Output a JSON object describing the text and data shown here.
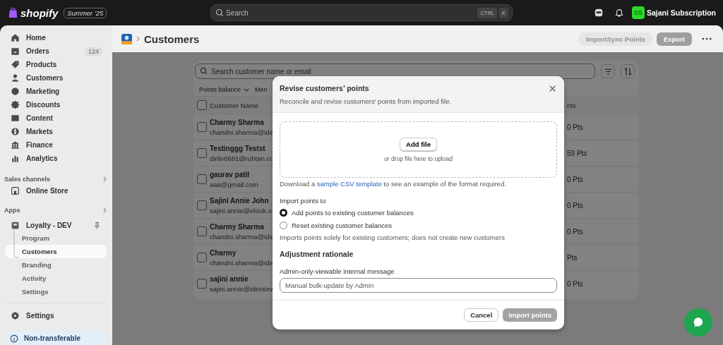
{
  "topbar": {
    "logo": "shopify",
    "edition_badge": "Summer '25",
    "search": {
      "placeholder": "Search",
      "shortcut": [
        "CTRL",
        "K"
      ]
    },
    "account": {
      "initials": "SS",
      "name": "Sajani Subscription"
    }
  },
  "sidebar": {
    "items": [
      {
        "label": "Home",
        "selected": false
      },
      {
        "label": "Orders",
        "badge": "124",
        "selected": false
      },
      {
        "label": "Products",
        "selected": false
      },
      {
        "label": "Customers",
        "selected": false
      },
      {
        "label": "Marketing",
        "selected": false
      },
      {
        "label": "Discounts",
        "selected": false
      },
      {
        "label": "Content",
        "selected": false
      },
      {
        "label": "Markets",
        "selected": false
      },
      {
        "label": "Finance",
        "selected": false
      },
      {
        "label": "Analytics",
        "selected": false
      }
    ],
    "sales_channels": {
      "title": "Sales channels",
      "items": [
        {
          "label": "Online Store",
          "selected": false
        }
      ]
    },
    "apps": {
      "title": "Apps",
      "app": {
        "label": "Loyalty - DEV",
        "children": [
          {
            "label": "Program",
            "selected": false
          },
          {
            "label": "Customers",
            "selected": true
          },
          {
            "label": "Branding",
            "selected": false
          },
          {
            "label": "Activity",
            "selected": false
          },
          {
            "label": "Settings",
            "selected": false
          }
        ]
      }
    },
    "settings": {
      "label": "Settings"
    },
    "notice": {
      "label": "Non-transferable"
    }
  },
  "page": {
    "title": "Customers",
    "actions": [
      {
        "label": "ImportSync Points",
        "kind": "secondary",
        "disabled": true
      },
      {
        "label": "Export",
        "kind": "primary",
        "disabled": true
      }
    ]
  },
  "table": {
    "search": {
      "placeholder": "Search customer name or email"
    },
    "filters": [
      "Points balance",
      "Men"
    ],
    "select_all_checked": false,
    "columns": [
      "Customer Name",
      "nts"
    ],
    "rows": [
      {
        "name": "Charmy Sharma",
        "email": "chandni.sharma@ide",
        "points": "0 Pts",
        "checked": false
      },
      {
        "name": "Testinggg Testst",
        "email": "dirile6881@ruhtan.co",
        "points": "59 Pts",
        "checked": false
      },
      {
        "name": "gaurav patil",
        "email": "aaa@gmail.com",
        "points": "0 Pts",
        "checked": false
      },
      {
        "name": "Sajini Annie John",
        "email": "sajini.annie@elook.o",
        "points": "0 Pts",
        "checked": false
      },
      {
        "name": "Charmy Sharma",
        "email": "chandni.sharma@ide",
        "points": "0 Pts",
        "checked": false
      },
      {
        "name": "Charmy",
        "email": "chandni.sharma@ide",
        "points": "Pts",
        "checked": false
      },
      {
        "name": "sajini annie",
        "email": "sajini.annie@identixv",
        "points": "0 Pts",
        "checked": false
      }
    ]
  },
  "modal": {
    "title": "Revise customers’ points",
    "subtitle": "Reconcile and revise customers' points from imported file.",
    "dropzone": {
      "button": "Add file",
      "hint": "or drop file here to upload"
    },
    "download": {
      "before": "Download a ",
      "link": "sample CSV template",
      "after": " to see an example of the format required."
    },
    "import_to": {
      "label": "Import points to",
      "options": [
        {
          "label": "Add points to existing customer balances",
          "selected": true
        },
        {
          "label": "Reset existing customer balances",
          "selected": false
        }
      ],
      "note": "Imports points solely for existing customers; does not create new customers"
    },
    "rationale": {
      "heading": "Adjustment rationale",
      "label": "Admin-only-viewable internal message",
      "value": "Manual bulk-update by Admin"
    },
    "buttons": [
      {
        "label": "Cancel",
        "kind": "secondary",
        "disabled": false
      },
      {
        "label": "Import points",
        "kind": "primary",
        "disabled": true
      }
    ]
  }
}
